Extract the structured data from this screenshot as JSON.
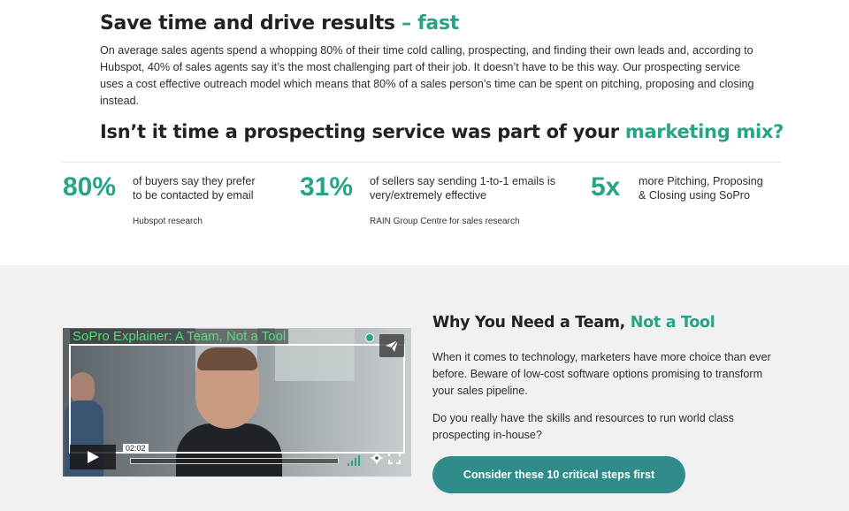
{
  "section_top": {
    "heading_main": "Save time and drive results",
    "heading_accent": " – fast",
    "intro": "On average sales agents spend a whopping 80% of their time cold calling, prospecting, and finding their own leads and, according to Hubspot, 40% of sales agents say it’s the most challenging part of their job. It doesn’t have to be this way. Our prospecting service uses a cost effective outreach model which means that 80% of a sales person’s time can be spent on pitching, proposing and closing instead.",
    "subheading_main": "Isn’t it time a prospecting service was part of your ",
    "subheading_accent": "marketing mix?"
  },
  "stats": [
    {
      "value": "80%",
      "text": "of buyers say they prefer to be contacted by email",
      "source": "Hubspot research"
    },
    {
      "value": "31%",
      "text": "of sellers say sending 1-to-1 emails is very/extremely effective",
      "source": "RAIN Group Centre for sales research"
    },
    {
      "value": "5x",
      "text": "more Pitching, Proposing & Closing using SoPro",
      "source": ""
    }
  ],
  "video": {
    "title": "SoPro Explainer: A Team, Not a Tool",
    "time": "02:02",
    "progress": 0
  },
  "section_bottom": {
    "title_main": "Why You Need a Team, ",
    "title_accent": "Not a Tool",
    "para1": "When it comes to technology, marketers have more choice than ever before. Beware of low-cost software options promising to transform your sales pipeline.",
    "para2": "Do you really have the skills and resources to run world class prospecting in-house?",
    "cta_label": "Consider these 10 critical steps first"
  },
  "colors": {
    "accent": "#27a486",
    "cta": "#308c8b",
    "band": "#f1f1f1"
  }
}
